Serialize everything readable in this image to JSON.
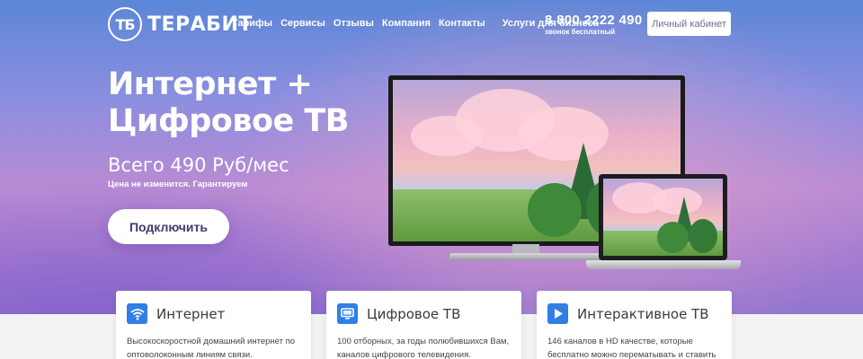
{
  "header": {
    "logo_mark": "ТБ",
    "logo_text": "ТЕРАБИТ",
    "nav": [
      "Тарифы",
      "Сервисы",
      "Отзывы",
      "Компания",
      "Контакты"
    ],
    "business": "Услуги для бизнеса",
    "phone": "8 800 2222 490",
    "phone_note": "звонок бесплатный",
    "cabinet": "Личный кабинет"
  },
  "hero": {
    "title_line1": "Интернет +",
    "title_line2": "Цифровое ТВ",
    "price": "Всего 490 Руб/мес",
    "guarantee": "Цена не изменится. Гарантируем",
    "connect": "Подключить"
  },
  "cards": [
    {
      "icon": "wifi-icon",
      "title": "Интернет",
      "text": "Высокоскоростной домашний интернет по оптоволоконным линиям связи."
    },
    {
      "icon": "tv-icon",
      "title": "Цифровое ТВ",
      "text": "100 отборных, за годы полюбившихся Вам, каналов цифрового телевидения."
    },
    {
      "icon": "play-icon",
      "title": "Интерактивное ТВ",
      "text": "146 каналов в HD качестве, которые бесплатно можно перематывать и ставить"
    }
  ],
  "colors": {
    "accent": "#2f7fe6",
    "button_text": "#3d3e6e"
  }
}
